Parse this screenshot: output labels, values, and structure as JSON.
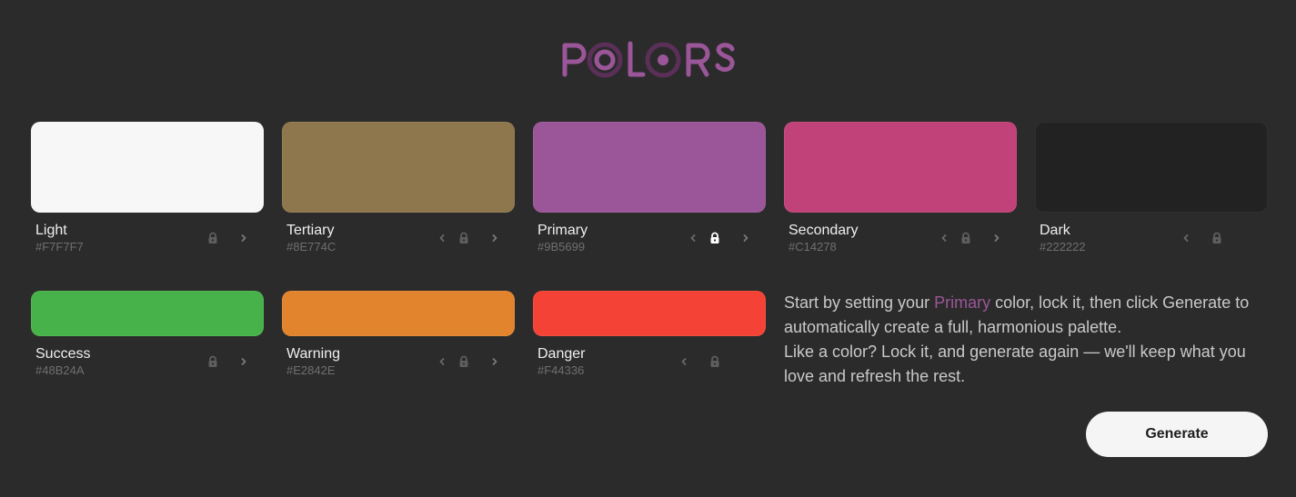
{
  "app": {
    "logo_text": "POLORS",
    "logo_color": "#9b5699"
  },
  "colors": [
    {
      "id": "light",
      "name": "Light",
      "hex": "#F7F7F7",
      "locked": false,
      "has_prev": false,
      "has_next": true
    },
    {
      "id": "tertiary",
      "name": "Tertiary",
      "hex": "#8E774C",
      "locked": false,
      "has_prev": true,
      "has_next": true
    },
    {
      "id": "primary",
      "name": "Primary",
      "hex": "#9B5699",
      "locked": true,
      "has_prev": true,
      "has_next": true
    },
    {
      "id": "secondary",
      "name": "Secondary",
      "hex": "#C14278",
      "locked": false,
      "has_prev": true,
      "has_next": true
    },
    {
      "id": "dark",
      "name": "Dark",
      "hex": "#222222",
      "locked": false,
      "has_prev": true,
      "has_next": false
    },
    {
      "id": "success",
      "name": "Success",
      "hex": "#48B24A",
      "locked": false,
      "has_prev": false,
      "has_next": true
    },
    {
      "id": "warning",
      "name": "Warning",
      "hex": "#E2842E",
      "locked": false,
      "has_prev": true,
      "has_next": true
    },
    {
      "id": "danger",
      "name": "Danger",
      "hex": "#F44336",
      "locked": false,
      "has_prev": true,
      "has_next": false
    }
  ],
  "instructions": {
    "line1_prefix": "Start by setting your ",
    "line1_highlight": "Primary",
    "line1_suffix": " color, lock it, then click Generate to automatically create a full, harmonious palette.",
    "line2": "Like a color? Lock it, and generate again — we'll keep what you love and refresh the rest."
  },
  "generate_button": {
    "label": "Generate"
  },
  "icons": {
    "prev": "chevron-left-icon",
    "next": "chevron-right-icon",
    "lock": "lock-icon"
  }
}
